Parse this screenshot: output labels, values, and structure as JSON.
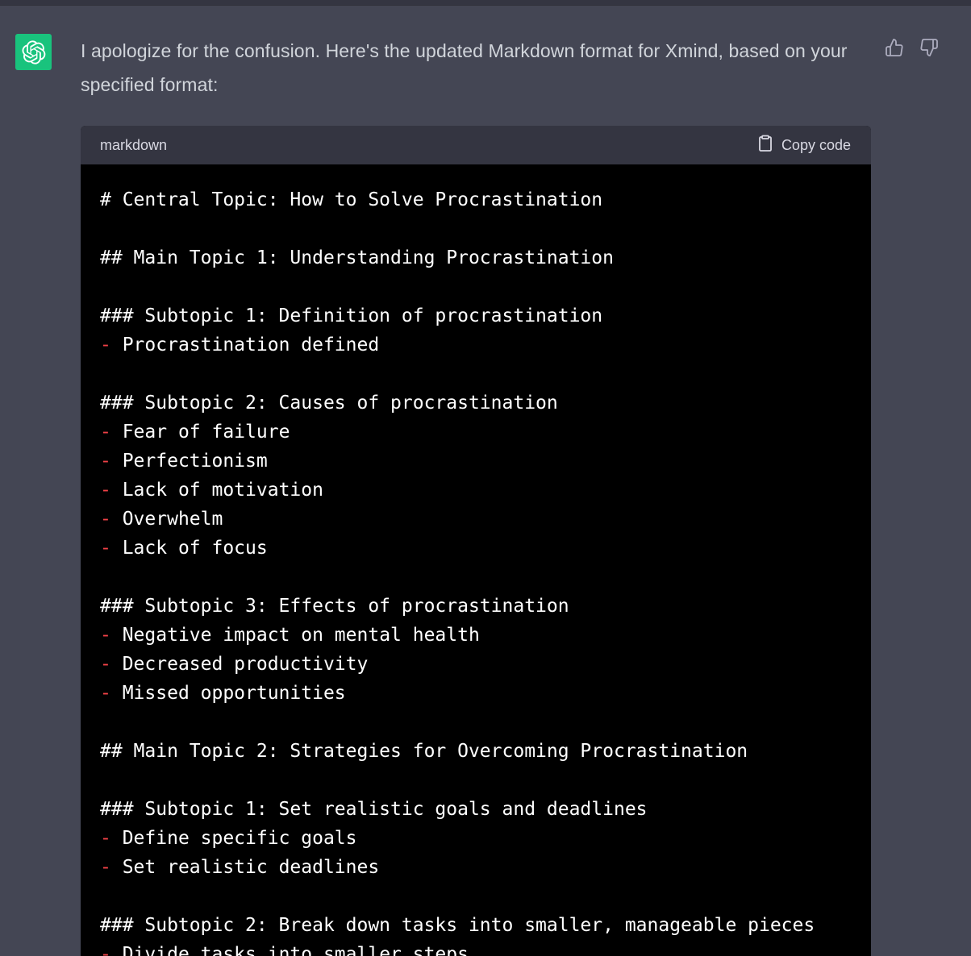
{
  "message": {
    "text": "I apologize for the confusion. Here's the updated Markdown format for Xmind, based on your specified format:"
  },
  "avatar": {
    "icon": "openai-logo-icon",
    "bg_color": "#19c37d"
  },
  "feedback": {
    "thumbs_up_icon": "thumbs-up-icon",
    "thumbs_down_icon": "thumbs-down-icon"
  },
  "code_block": {
    "language": "markdown",
    "copy_label": "Copy code",
    "copy_icon": "clipboard-icon",
    "lines": [
      {
        "dash": "",
        "text": "# Central Topic: How to Solve Procrastination"
      },
      {
        "dash": "",
        "text": ""
      },
      {
        "dash": "",
        "text": "## Main Topic 1: Understanding Procrastination"
      },
      {
        "dash": "",
        "text": ""
      },
      {
        "dash": "",
        "text": "### Subtopic 1: Definition of procrastination"
      },
      {
        "dash": "-",
        "text": " Procrastination defined"
      },
      {
        "dash": "",
        "text": ""
      },
      {
        "dash": "",
        "text": "### Subtopic 2: Causes of procrastination"
      },
      {
        "dash": "-",
        "text": " Fear of failure"
      },
      {
        "dash": "-",
        "text": " Perfectionism"
      },
      {
        "dash": "-",
        "text": " Lack of motivation"
      },
      {
        "dash": "-",
        "text": " Overwhelm"
      },
      {
        "dash": "-",
        "text": " Lack of focus"
      },
      {
        "dash": "",
        "text": ""
      },
      {
        "dash": "",
        "text": "### Subtopic 3: Effects of procrastination"
      },
      {
        "dash": "-",
        "text": " Negative impact on mental health"
      },
      {
        "dash": "-",
        "text": " Decreased productivity"
      },
      {
        "dash": "-",
        "text": " Missed opportunities"
      },
      {
        "dash": "",
        "text": ""
      },
      {
        "dash": "",
        "text": "## Main Topic 2: Strategies for Overcoming Procrastination"
      },
      {
        "dash": "",
        "text": ""
      },
      {
        "dash": "",
        "text": "### Subtopic 1: Set realistic goals and deadlines"
      },
      {
        "dash": "-",
        "text": " Define specific goals"
      },
      {
        "dash": "-",
        "text": " Set realistic deadlines"
      },
      {
        "dash": "",
        "text": ""
      },
      {
        "dash": "",
        "text": "### Subtopic 2: Break down tasks into smaller, manageable pieces"
      },
      {
        "dash": "-",
        "text": " Divide tasks into smaller steps"
      }
    ]
  }
}
